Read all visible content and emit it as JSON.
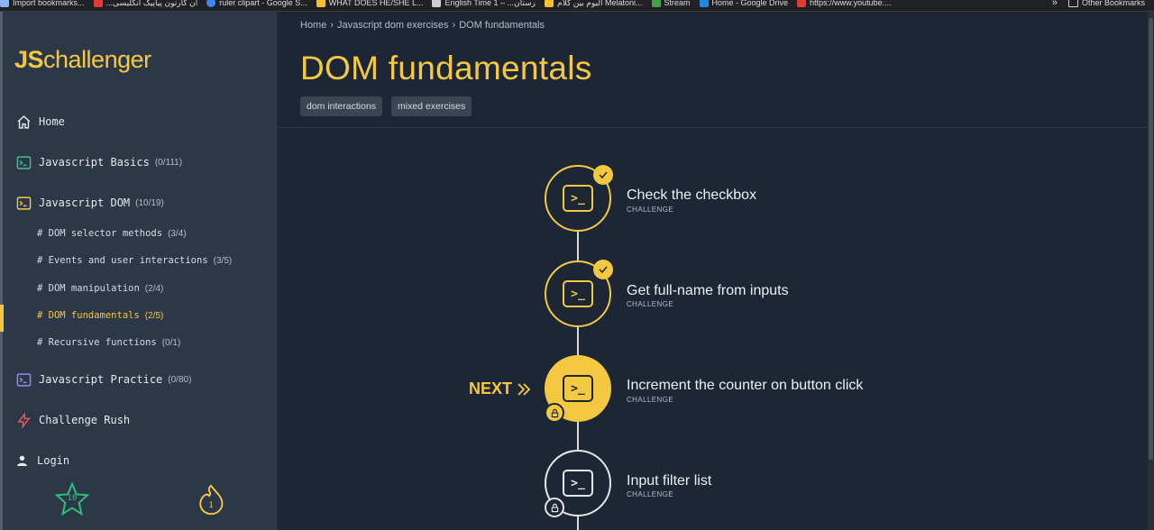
{
  "bookmarks": {
    "items": [
      {
        "label": "Import bookmarks...",
        "color": "#8ab4f8"
      },
      {
        "label": "...ان کارتون پیاپیک انکلیسی",
        "color": "#e53935"
      },
      {
        "label": "ruler clipart - Google S...",
        "color": "#4285f4"
      },
      {
        "label": "WHAT DOES HE/SHE L...",
        "color": "#fbc02d"
      },
      {
        "label": "English Time 1 – ...رستان",
        "color": "#cfcfcf"
      },
      {
        "label": "اليوم بين كلام Melatoni...",
        "color": "#fbc02d"
      },
      {
        "label": "Stream",
        "color": "#43a047"
      },
      {
        "label": "Home - Google Drive",
        "color": "#1e88e5"
      },
      {
        "label": "https://www.youtube....",
        "color": "#e53935"
      }
    ],
    "more": "»",
    "other": "Other Bookmarks"
  },
  "sidebar": {
    "logo_js": "JS",
    "logo_rest": "challenger",
    "nav": [
      {
        "label": "Home",
        "count": "",
        "icon": "home-icon",
        "color": "#e8e8e8"
      },
      {
        "label": "Javascript Basics",
        "count": "(0/111)",
        "icon": "terminal-icon",
        "color": "#3ec28f"
      },
      {
        "label": "Javascript DOM",
        "count": "(10/19)",
        "icon": "terminal-icon",
        "color": "#f5c842"
      },
      {
        "label": "Javascript Practice",
        "count": "(0/80)",
        "icon": "terminal-icon",
        "color": "#8c8ff0"
      },
      {
        "label": "Challenge Rush",
        "count": "",
        "icon": "lightning-icon",
        "color": "#e85a5a"
      },
      {
        "label": "Login",
        "count": "",
        "icon": "user-icon",
        "color": "#e8e8e8"
      }
    ],
    "sub": [
      {
        "label": "# DOM selector methods",
        "count": "(3/4)"
      },
      {
        "label": "# Events and user interactions",
        "count": "(3/5)"
      },
      {
        "label": "# DOM manipulation",
        "count": "(2/4)"
      },
      {
        "label": "# DOM fundamentals",
        "count": "(2/5)"
      },
      {
        "label": "# Recursive functions",
        "count": "(0/1)"
      }
    ],
    "star_count": "10",
    "flame_count": "1"
  },
  "main": {
    "breadcrumb": [
      "Home",
      "Javascript dom exercises",
      "DOM fundamentals"
    ],
    "title": "DOM fundamentals",
    "tags": [
      "dom interactions",
      "mixed exercises"
    ],
    "next_label": "NEXT",
    "challenges": [
      {
        "title": "Check the checkbox",
        "type": "CHALLENGE",
        "state": "done"
      },
      {
        "title": "Get full-name from inputs",
        "type": "CHALLENGE",
        "state": "done"
      },
      {
        "title": "Increment the counter on button click",
        "type": "CHALLENGE",
        "state": "next"
      },
      {
        "title": "Input filter list",
        "type": "CHALLENGE",
        "state": "locked"
      }
    ],
    "terminal_glyph": ">_"
  },
  "colors": {
    "accent": "#f5c842",
    "background": "#1d2635",
    "sidebar": "#2c3848"
  }
}
